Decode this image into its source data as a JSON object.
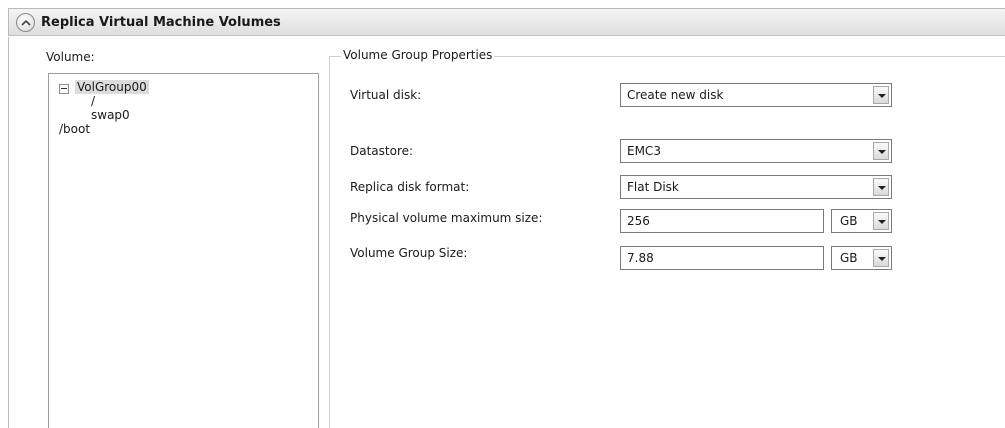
{
  "panel": {
    "title": "Replica Virtual Machine Volumes"
  },
  "volumes": {
    "label": "Volume:",
    "tree": [
      {
        "label": "VolGroup00",
        "expanded": true,
        "selected": true
      },
      {
        "label": "/"
      },
      {
        "label": "swap0"
      },
      {
        "label": "/boot"
      }
    ]
  },
  "properties": {
    "group_title": "Volume Group Properties",
    "virtual_disk": {
      "label": "Virtual disk:",
      "value": "Create new disk"
    },
    "datastore": {
      "label": "Datastore:",
      "value": "EMC3"
    },
    "disk_format": {
      "label": "Replica disk format:",
      "value": "Flat Disk"
    },
    "pv_max_size": {
      "label": "Physical volume maximum size:",
      "value": "256",
      "unit": "GB"
    },
    "vg_size": {
      "label": "Volume Group Size:",
      "value": "7.88",
      "unit": "GB"
    }
  },
  "icons": {
    "collapse": "chevron-up-icon",
    "dropdown": "chevron-down-icon",
    "tree_toggle": "minus-box-icon"
  },
  "colors": {
    "header_bg": "#e6e6e6",
    "selection_bg": "#dcdcdc",
    "border": "#7a7a7a"
  }
}
